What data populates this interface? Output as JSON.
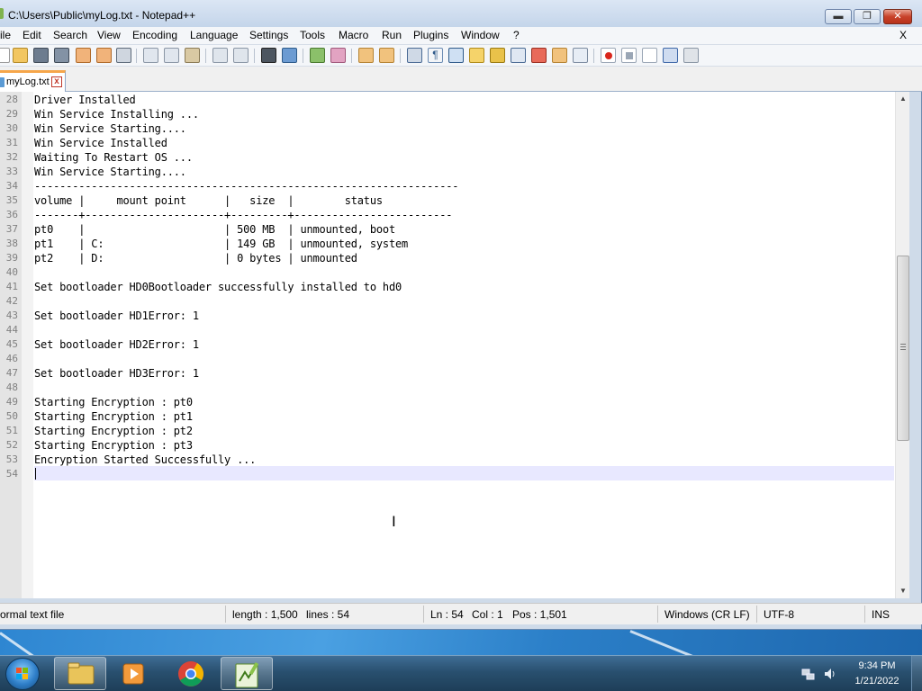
{
  "window": {
    "title": "C:\\Users\\Public\\myLog.txt - Notepad++",
    "minimize_label": "▬",
    "maximize_label": "❐",
    "close_label": "✕"
  },
  "menu": {
    "items": [
      "ile",
      "Edit",
      "Search",
      "View",
      "Encoding",
      "Language",
      "Settings",
      "Tools",
      "Macro",
      "Run",
      "Plugins",
      "Window",
      "?"
    ],
    "close_doc": "X"
  },
  "tab": {
    "label": "myLog.txt",
    "close_label": "x"
  },
  "editor": {
    "lines": [
      {
        "n": "28",
        "text": "Driver Installed"
      },
      {
        "n": "29",
        "text": "Win Service Installing ..."
      },
      {
        "n": "30",
        "text": "Win Service Starting...."
      },
      {
        "n": "31",
        "text": "Win Service Installed"
      },
      {
        "n": "32",
        "text": "Waiting To Restart OS ..."
      },
      {
        "n": "33",
        "text": "Win Service Starting...."
      },
      {
        "n": "34",
        "text": "-------------------------------------------------------------------"
      },
      {
        "n": "35",
        "text": "volume |     mount point      |   size  |        status"
      },
      {
        "n": "36",
        "text": "-------+----------------------+---------+-------------------------"
      },
      {
        "n": "37",
        "text": "pt0    |                      | 500 MB  | unmounted, boot"
      },
      {
        "n": "38",
        "text": "pt1    | C:                   | 149 GB  | unmounted, system"
      },
      {
        "n": "39",
        "text": "pt2    | D:                   | 0 bytes | unmounted"
      },
      {
        "n": "40",
        "text": ""
      },
      {
        "n": "41",
        "text": "Set bootloader HD0Bootloader successfully installed to hd0"
      },
      {
        "n": "42",
        "text": ""
      },
      {
        "n": "43",
        "text": "Set bootloader HD1Error: 1"
      },
      {
        "n": "44",
        "text": ""
      },
      {
        "n": "45",
        "text": "Set bootloader HD2Error: 1"
      },
      {
        "n": "46",
        "text": ""
      },
      {
        "n": "47",
        "text": "Set bootloader HD3Error: 1"
      },
      {
        "n": "48",
        "text": ""
      },
      {
        "n": "49",
        "text": "Starting Encryption : pt0"
      },
      {
        "n": "50",
        "text": "Starting Encryption : pt1"
      },
      {
        "n": "51",
        "text": "Starting Encryption : pt2"
      },
      {
        "n": "52",
        "text": "Starting Encryption : pt3"
      },
      {
        "n": "53",
        "text": "Encryption Started Successfully ..."
      },
      {
        "n": "54",
        "text": ""
      }
    ]
  },
  "statusbar": {
    "file_type": "ormal text file",
    "length": "length : 1,500",
    "lines": "lines : 54",
    "ln": "Ln : 54",
    "col": "Col : 1",
    "pos": "Pos : 1,501",
    "eol": "Windows (CR LF)",
    "encoding": "UTF-8",
    "mode": "INS"
  },
  "taskbar": {
    "time": "9:34 PM",
    "date": "1/21/2022",
    "apps": [
      "folder-icon",
      "media-player-icon",
      "chrome-icon",
      "notepadpp-icon"
    ]
  },
  "toolbar": {
    "icons": [
      "new-file-icon",
      "open-file-icon",
      "save-icon",
      "save-all-icon",
      "close-icon",
      "close-all-icon",
      "print-icon",
      "cut-icon",
      "copy-icon",
      "paste-icon",
      "undo-icon",
      "redo-icon",
      "find-icon",
      "replace-icon",
      "zoom-in-icon",
      "zoom-out-icon",
      "sync-v-icon",
      "sync-h-icon",
      "word-wrap-icon",
      "show-all-chars-icon",
      "indent-guide-icon",
      "udl-icon",
      "doc-map-icon",
      "function-list-icon",
      "folder-workspace-icon",
      "monitor-icon",
      "record-macro-icon",
      "stop-macro-icon",
      "play-macro-icon",
      "run-macro-icon",
      "save-macro-icon"
    ]
  },
  "colors": {
    "accent_tab": "#f6a64a",
    "current_line": "#e8e8ff",
    "taskbar": "#29506f"
  }
}
